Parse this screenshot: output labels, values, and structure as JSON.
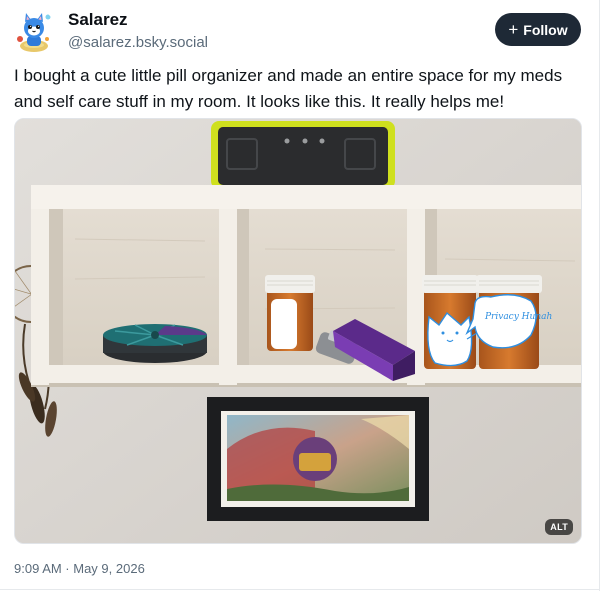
{
  "post": {
    "author": {
      "display_name": "Salarez",
      "handle": "@salarez.bsky.social",
      "avatar_icon": "blue-cat-cartoon-avatar"
    },
    "follow_button": {
      "icon": "plus-icon",
      "label": "Follow"
    },
    "text": "I bought a cute little pill organizer and made an entire space for my meds and self care stuff in my room. It looks like this. It really helps me!",
    "image": {
      "alt_badge": "ALT",
      "drawn_label": "Privacy Hunah"
    },
    "timestamp": "9:09 AM · May 9, 2026"
  },
  "colors": {
    "follow_button_bg": "#1e2936",
    "secondary_text": "#5b6b7a",
    "speaker_frame": "#cfe01e",
    "doodle_stroke": "#2f8fe0",
    "lighter_purple": "#7a3db3"
  }
}
